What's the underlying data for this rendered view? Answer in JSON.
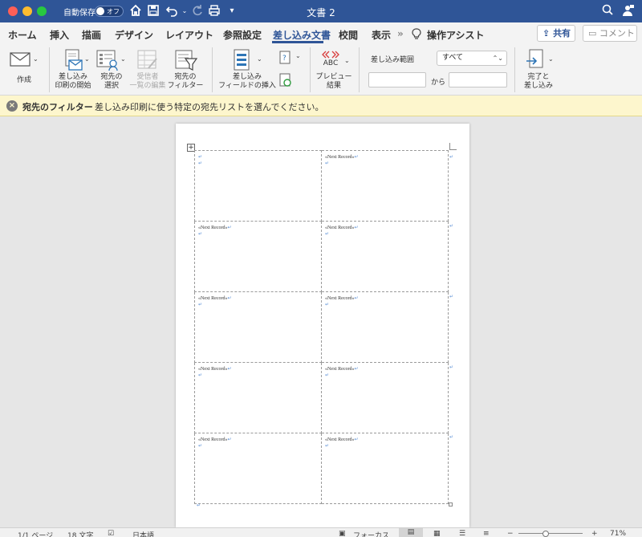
{
  "titlebar": {
    "autosave_label": "自動保存",
    "autosave_state": "オフ",
    "document_title": "文書 2"
  },
  "tabs": [
    {
      "label": "ホーム"
    },
    {
      "label": "挿入"
    },
    {
      "label": "描画"
    },
    {
      "label": "デザイン"
    },
    {
      "label": "レイアウト"
    },
    {
      "label": "参照設定"
    },
    {
      "label": "差し込み文書",
      "active": true
    },
    {
      "label": "校閲"
    },
    {
      "label": "表示"
    },
    {
      "label": "操作アシスト"
    }
  ],
  "actions": {
    "share": "共有",
    "comment": "コメント"
  },
  "ribbon": {
    "create": "作成",
    "start_merge_1": "差し込み",
    "start_merge_2": "印刷の開始",
    "select_recipients_1": "宛先の",
    "select_recipients_2": "選択",
    "edit_list_1": "受信者",
    "edit_list_2": "一覧の編集",
    "filter_1": "宛先の",
    "filter_2": "フィルター",
    "insert_field_1": "差し込み",
    "insert_field_2": "フィールドの挿入",
    "preview_1": "プレビュー",
    "preview_2": "結果",
    "preview_icon_text": "ABC",
    "merge_range_label": "差し込み範囲",
    "merge_range_value": "すべて",
    "range_to": "から",
    "finish_1": "完了と",
    "finish_2": "差し込み"
  },
  "message_bar": {
    "title": "宛先のフィルター",
    "text": "差し込み印刷に使う特定の宛先リストを選んでください。"
  },
  "document": {
    "next_record": "«Next Record»",
    "paragraph_mark": "↵"
  },
  "statusbar": {
    "page": "1/1 ページ",
    "words": "18 文字",
    "language": "日本語",
    "focus": "フォーカス",
    "zoom": "71%"
  },
  "colors": {
    "titlebar": "#2f5597",
    "accent": "#2f5597",
    "message_bar": "#fdf6cd"
  }
}
